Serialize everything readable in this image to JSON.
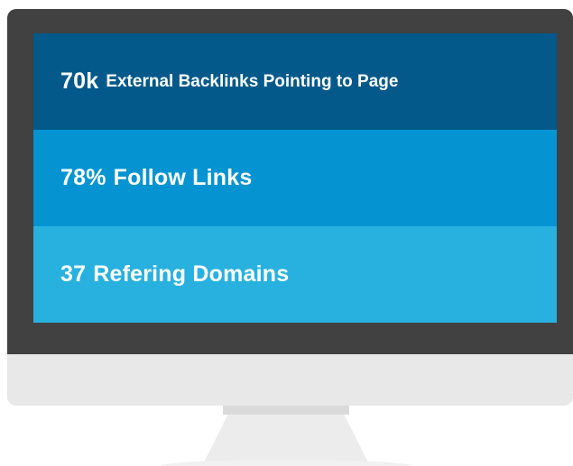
{
  "stats": [
    {
      "value": "70k",
      "label": "External Backlinks Pointing to Page",
      "color": "#02598a"
    },
    {
      "value": "78%",
      "label": "Follow Links",
      "color": "#0594d1"
    },
    {
      "value": "37",
      "label": "Refering Domains",
      "color": "#28b1df"
    }
  ],
  "colors": {
    "bezel": "#414141",
    "chin": "#e8e8e8",
    "stand": "#ececec"
  }
}
